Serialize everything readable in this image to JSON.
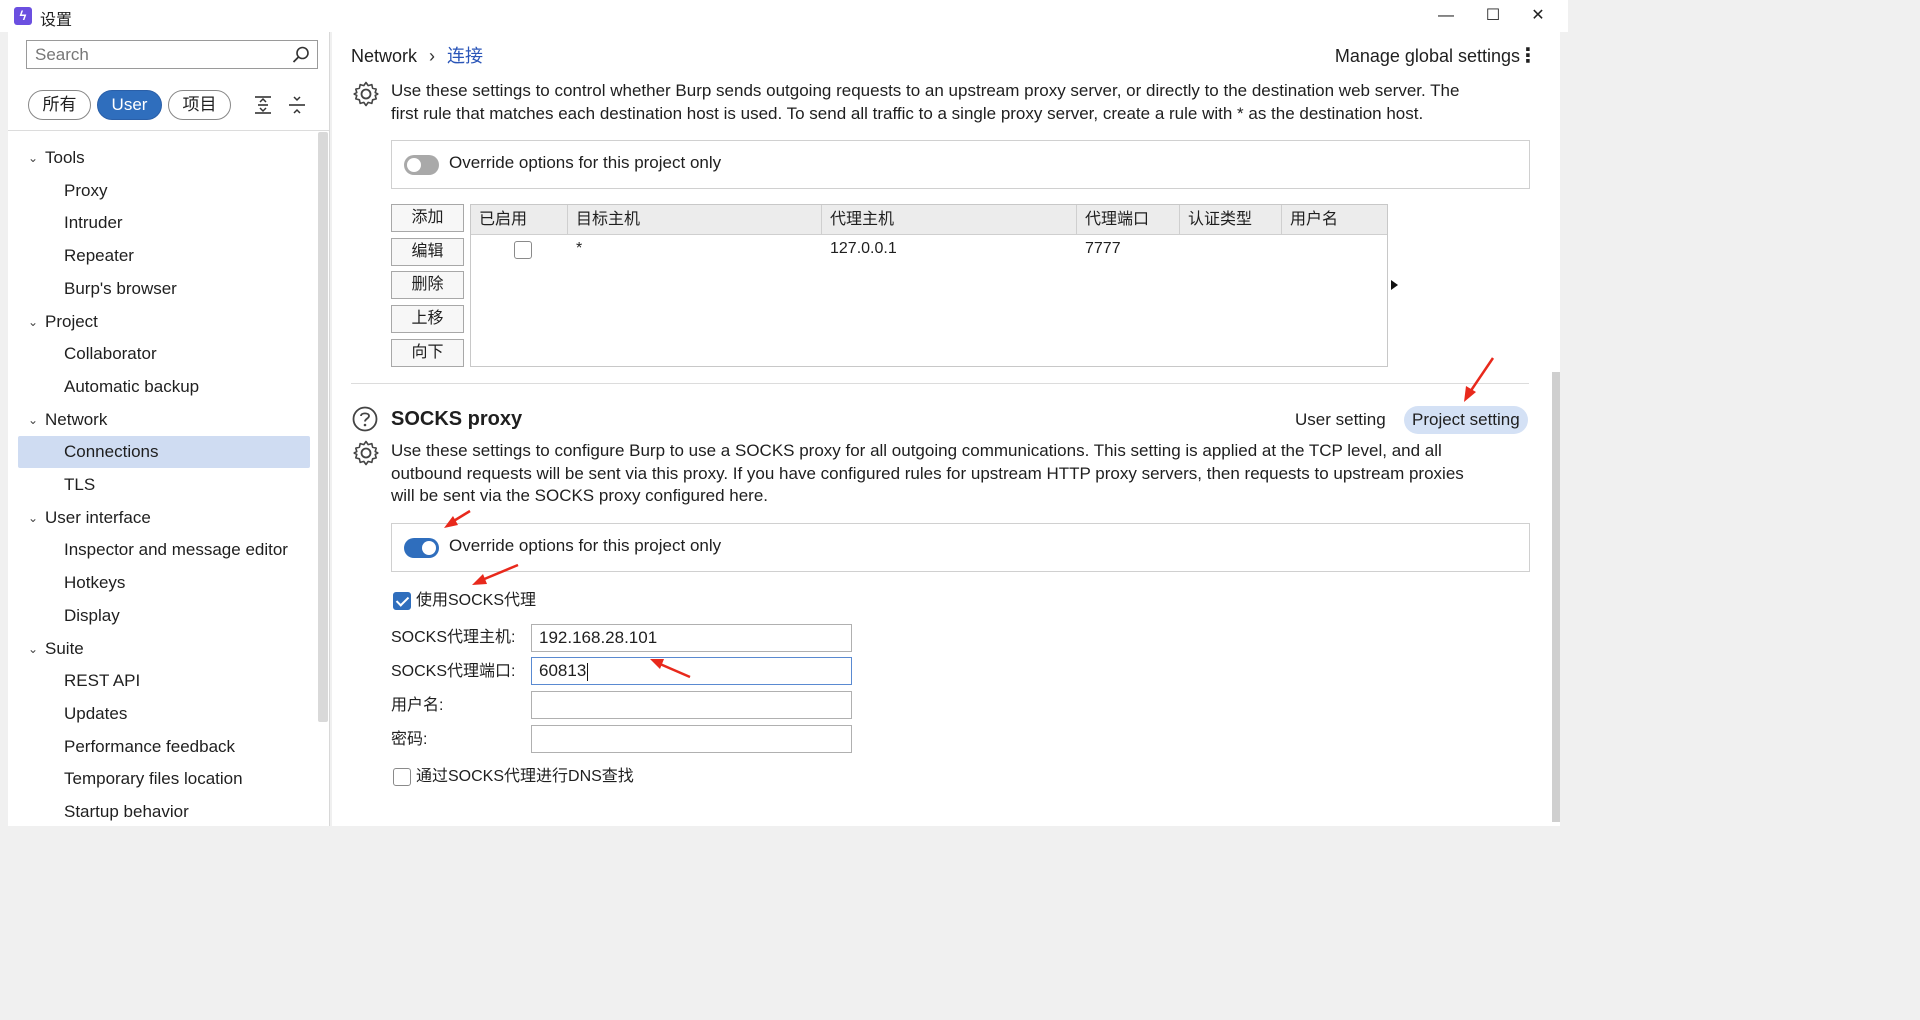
{
  "window": {
    "title": "设置",
    "minimize": "—",
    "maximize": "☐",
    "close": "✕"
  },
  "sidebar": {
    "search_placeholder": "Search",
    "filters": [
      "所有",
      "User",
      "项目"
    ],
    "active_filter": "User",
    "tree": [
      {
        "label": "Tools",
        "type": "group"
      },
      {
        "label": "Proxy",
        "type": "child"
      },
      {
        "label": "Intruder",
        "type": "child"
      },
      {
        "label": "Repeater",
        "type": "child"
      },
      {
        "label": "Burp's browser",
        "type": "child"
      },
      {
        "label": "Project",
        "type": "group"
      },
      {
        "label": "Collaborator",
        "type": "child"
      },
      {
        "label": "Automatic backup",
        "type": "child"
      },
      {
        "label": "Network",
        "type": "group"
      },
      {
        "label": "Connections",
        "type": "child",
        "selected": true
      },
      {
        "label": "TLS",
        "type": "child"
      },
      {
        "label": "User interface",
        "type": "group"
      },
      {
        "label": "Inspector and message editor",
        "type": "child"
      },
      {
        "label": "Hotkeys",
        "type": "child"
      },
      {
        "label": "Display",
        "type": "child"
      },
      {
        "label": "Suite",
        "type": "group"
      },
      {
        "label": "REST API",
        "type": "child"
      },
      {
        "label": "Updates",
        "type": "child"
      },
      {
        "label": "Performance feedback",
        "type": "child"
      },
      {
        "label": "Temporary files location",
        "type": "child"
      },
      {
        "label": "Startup behavior",
        "type": "child"
      }
    ]
  },
  "header": {
    "breadcrumb_root": "Network",
    "breadcrumb_sep": "›",
    "breadcrumb_current": "连接",
    "manage_label": "Manage global settings",
    "kebab": "⋮"
  },
  "upstream": {
    "description_line1": "Use these settings to control whether Burp sends outgoing requests to an upstream proxy server, or directly to the destination web server. The",
    "description_line2": "first rule that matches each destination host is used. To send all traffic to a single proxy server, create a rule with * as the destination host.",
    "override_label": "Override options for this project only",
    "override_on": false,
    "buttons": [
      "添加",
      "编辑",
      "删除",
      "上移",
      "向下"
    ],
    "columns": [
      "已启用",
      "目标主机",
      "代理主机",
      "代理端口",
      "认证类型",
      "用户名"
    ],
    "rows": [
      {
        "enabled": false,
        "dest_host": "*",
        "proxy_host": "127.0.0.1",
        "proxy_port": "7777",
        "auth_type": "",
        "username": ""
      }
    ]
  },
  "socks": {
    "title": "SOCKS proxy",
    "user_setting": "User setting",
    "project_setting": "Project setting",
    "description_line1": "Use these settings to configure Burp to use a SOCKS proxy for all outgoing communications. This setting is applied at the TCP level, and all",
    "description_line2": "outbound requests will be sent via this proxy. If you have configured rules for upstream HTTP proxy servers, then requests to upstream proxies",
    "description_line3": "will be sent via the SOCKS proxy configured here.",
    "override_label": "Override options for this project only",
    "override_on": true,
    "use_socks_label": "使用SOCKS代理",
    "use_socks_checked": true,
    "host_label": "SOCKS代理主机:",
    "host_value": "192.168.28.101",
    "port_label": "SOCKS代理端口:",
    "port_value": "60813",
    "username_label": "用户名:",
    "username_value": "",
    "password_label": "密码:",
    "password_value": "",
    "dns_label": "通过SOCKS代理进行DNS查找",
    "dns_checked": false
  },
  "colors": {
    "accent": "#2f6ebd",
    "annotation_red": "#e8291c",
    "selected_bg": "#cfdcf2"
  }
}
